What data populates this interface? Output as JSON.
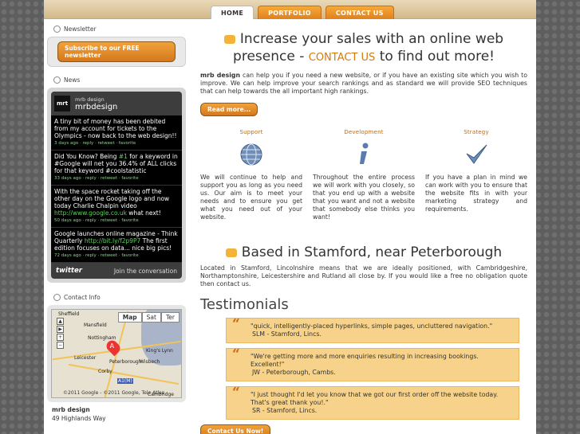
{
  "nav": {
    "tabs": [
      {
        "label": "HOME"
      },
      {
        "label": "PORTFOLIO"
      },
      {
        "label": "CONTACT US"
      }
    ]
  },
  "sidebar": {
    "newsletter_title": "Newsletter",
    "newsletter_button": "Subscribe to our FREE newsletter",
    "news_title": "News",
    "twitter": {
      "logo_text": "mrt",
      "name": "mrb design",
      "handle": "mrbdesign",
      "tweets": [
        {
          "pre": "A tiny bit of money has been debited from my account for tickets to the Olympics - now back to the web design!!",
          "hl": "",
          "post": "",
          "meta": "3 days ago · reply · retweet · favorite"
        },
        {
          "pre": "Did You Know? Being ",
          "hl": "#1",
          "post": " for a keyword in #Google will net you 36.4% of ALL clicks for that keyword #coolstatistic",
          "meta": "33 days ago · reply · retweet · favorite"
        },
        {
          "pre": "With the space rocket taking off the other day on the Google logo and now today Charlie Chalpin video ",
          "hl": "http://www.google.co.uk",
          "post": " what next!",
          "meta": "50 days ago · reply · retweet · favorite"
        },
        {
          "pre": "Google launches online magazine - Think Quarterly ",
          "hl": "http://bit.ly/f2p9P7",
          "post": " The first edition focuses on data... nice big pics!",
          "meta": "72 days ago · reply · retweet · favorite"
        }
      ],
      "footer_logo": "twitter",
      "footer_link": "Join the conversation"
    },
    "contact_title": "Contact Info",
    "map": {
      "types": [
        "Map",
        "Sat",
        "Ter"
      ],
      "labels": [
        "Sheffield",
        "Mansfield",
        "Nottingham",
        "Leicester",
        "Peterborough",
        "Corby",
        "King's Lynn",
        "Wisbech",
        "Cambridge",
        "A1(M)"
      ],
      "copyright": "©2011 Google - ©2011 Google, Tele Atlas",
      "pin": "A"
    },
    "address": [
      "mrb design",
      "49 Highlands Way"
    ]
  },
  "main": {
    "headline_pre": "Increase your sales with an online web presence -",
    "headline_contact": "CONTACT US",
    "headline_post": "to find out more!",
    "intro_bold": "mrb design",
    "intro_text": " can help you if you need a new website, or if you have an existing site which you wish to improve. We can help improve your search rankings and as standard we will provide SEO techniques that can help towards the all important high rankings.",
    "read_more": "Read more...",
    "columns": [
      {
        "title": "Support",
        "icon": "globe-icon",
        "text": "We will continue to help and support you as long as you need us. Our aim is to meet your needs and to ensure you get what you need out of your website."
      },
      {
        "title": "Development",
        "icon": "info-icon",
        "text": "Throughout the entire process we will work with you closely, so that you end up with a website that you want and not a website that somebody else thinks you want!"
      },
      {
        "title": "Strategy",
        "icon": "checkmark-icon",
        "text": "If you have a plan in mind we can work with you to ensure that the website fits in with your marketing strategy and requirements."
      }
    ],
    "location_title": "Based in Stamford, near Peterborough",
    "location_text": "Located in Stamford, Lincolnshire means that we are ideally positioned, with Cambridgeshire, Northamptonshire, Leicestershire and Rutland all close by. If you would like a free no obligation quote then contact us.",
    "testimonials_title": "Testimonials",
    "testimonials": [
      {
        "quote": "\"quick, intelligently-placed hyperlinks, simple pages, uncluttered navigation.\"",
        "who": "SLM - Stamford, Lincs."
      },
      {
        "quote": "\"We're getting more and more enquiries resulting in increasing bookings. Excellent!\"",
        "who": "JW - Peterborough, Cambs."
      },
      {
        "quote": "\"I just thought I'd let you know that we got our first order off the website today. That's great thank you!.\"",
        "who": "SR - Stamford, Lincs."
      }
    ],
    "contact_now": "Contact Us Now!"
  }
}
